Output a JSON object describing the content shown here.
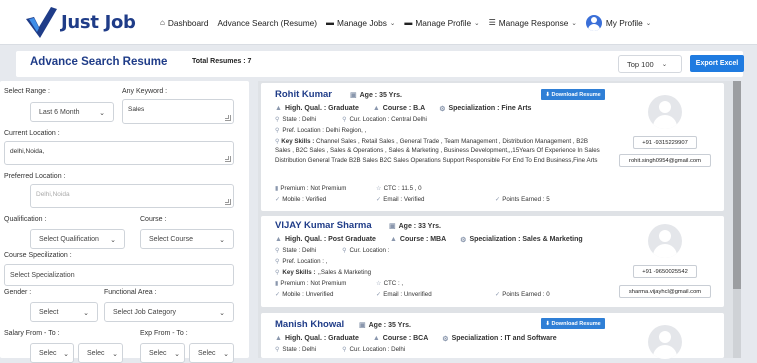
{
  "brand": {
    "name": "Just Job"
  },
  "nav": {
    "dashboard": "Dashboard",
    "advance_search": "Advance Search (Resume)",
    "manage_jobs": "Manage Jobs",
    "manage_profile": "Manage Profile",
    "manage_response": "Manage Response",
    "my_profile": "My Profile"
  },
  "header": {
    "title": "Advance Search Resume",
    "total": "Total Resumes : 7",
    "top_select": "Top 100",
    "export_label": "Export Excel"
  },
  "filters": {
    "select_range_label": "Select Range :",
    "select_range_value": "Last 6 Month",
    "keyword_label": "Any Keyword :",
    "keyword_value": "Sales",
    "current_location_label": "Current Location :",
    "current_location_value": "delhi,Noida,",
    "preferred_location_label": "Preferred Location :",
    "preferred_location_placeholder": "Delhi,Noida",
    "qualification_label": "Qualification :",
    "qualification_value": "Select Qualification",
    "course_label": "Course :",
    "course_value": "Select Course",
    "course_spec_label": "Course Specilization :",
    "course_spec_value": "Select Specialization",
    "gender_label": "Gender :",
    "gender_value": "Select",
    "functional_area_label": "Functional Area :",
    "functional_area_value": "Select Job Category",
    "salary_label": "Salary From - To :",
    "exp_label": "Exp From - To :",
    "salary_from": "Selec",
    "salary_to": "Selec",
    "exp_from": "Selec",
    "exp_to": "Selec"
  },
  "candidates": [
    {
      "name": "Rohit Kumar",
      "age": "Age : 35 Yrs.",
      "download": "Download Resume",
      "qual_label": "High. Qual. : Graduate",
      "course": "Course : B.A",
      "spec": "Specialization : Fine Arts",
      "state": "State : Delhi",
      "cur_location": "Cur. Location : Central Delhi",
      "pref_location": "Pref. Location : Delhi Region, ,",
      "key_skills_label": "Key Skills :",
      "key_skills": "Channel Sales , Retail Sales , General Trade , Team Management , Distribution Management , B2B Sales , B2C Sales , Sales & Operations , Sales & Marketing , Business Development,,,15Years Of Experience In Sales Distribution General Trade B2B Sales B2C Sales Operations Support Responsible For End To End Business,Fine Arts",
      "premium": "Premium : Not Premium",
      "ctc": "CTC : 11.5 , 0",
      "mobile": "Mobile : Verified",
      "email": "Email : Verified",
      "points": "Points Earned : 5",
      "phone": "+91 -9315229907",
      "email_addr": "rohit.singh0954@gmail.com"
    },
    {
      "name": "VIJAY Kumar Sharma",
      "age": "Age : 33 Yrs.",
      "qual_label": "High. Qual. : Post Graduate",
      "course": "Course : MBA",
      "spec": "Specialization : Sales & Marketing",
      "state": "State : Delhi",
      "cur_location": "Cur. Location :",
      "pref_location": "Pref. Location : ,",
      "key_skills_label": "Key Skills :",
      "key_skills": ",,Sales & Marketing",
      "premium": "Premium : Not Premium",
      "ctc": "CTC : ,",
      "mobile": "Mobile : Unverified",
      "email": "Email : Unverified",
      "points": "Points Earned : 0",
      "phone": "+91 -9650025542",
      "email_addr": "sharma.vijayhcl@gmail.com"
    },
    {
      "name": "Manish Khowal",
      "age": "Age : 35 Yrs.",
      "download": "Download Resume",
      "qual_label": "High. Qual. : Graduate",
      "course": "Course : BCA",
      "spec": "Specialization : IT and Software",
      "state": "State : Delhi",
      "cur_location": "Cur. Location : Delhi"
    }
  ]
}
